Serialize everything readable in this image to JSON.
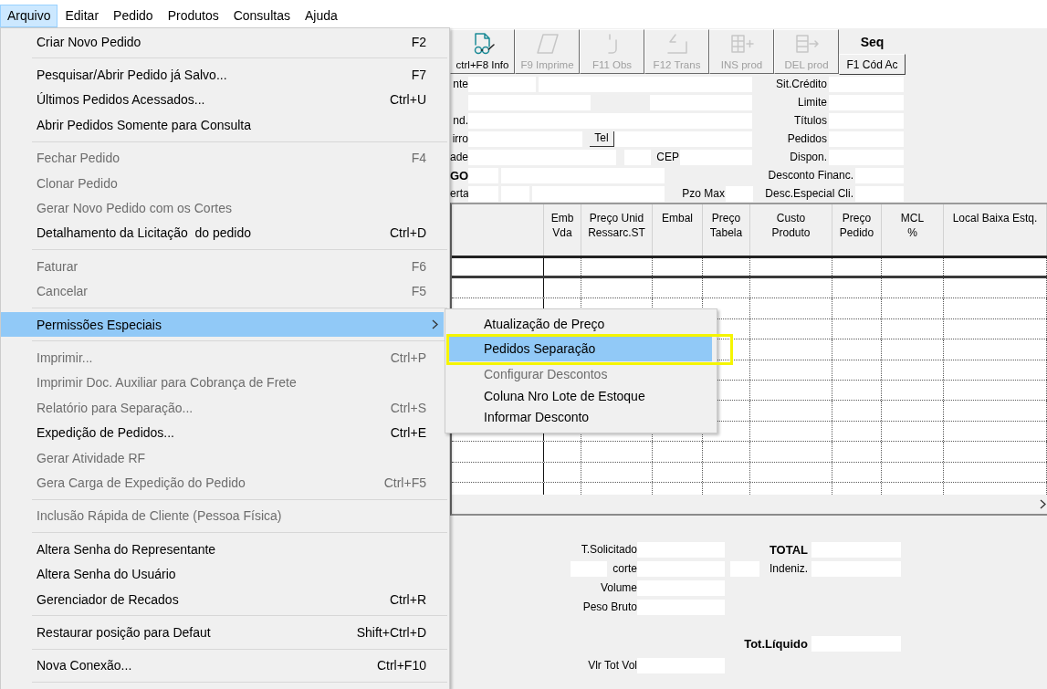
{
  "menu_bar": [
    {
      "label": "Arquivo",
      "selected": true
    },
    {
      "label": "Editar",
      "selected": false
    },
    {
      "label": "Pedido",
      "selected": false
    },
    {
      "label": "Produtos",
      "selected": false
    },
    {
      "label": "Consultas",
      "selected": false
    },
    {
      "label": "Ajuda",
      "selected": false
    }
  ],
  "file_menu": {
    "items": [
      {
        "kind": "item",
        "label": "Criar Novo Pedido",
        "shortcut": "F2",
        "disabled": false,
        "selected": false
      },
      {
        "kind": "separator"
      },
      {
        "kind": "item",
        "label": "Pesquisar/Abrir Pedido já Salvo...",
        "shortcut": "F7",
        "disabled": false,
        "selected": false
      },
      {
        "kind": "item",
        "label": "Últimos Pedidos Acessados...",
        "shortcut": "Ctrl+U",
        "disabled": false,
        "selected": false
      },
      {
        "kind": "item",
        "label": "Abrir Pedidos Somente para Consulta",
        "disabled": false,
        "selected": false
      },
      {
        "kind": "separator"
      },
      {
        "kind": "item",
        "label": "Fechar Pedido",
        "shortcut": "F4",
        "disabled": true,
        "selected": false
      },
      {
        "kind": "item",
        "label": "Clonar Pedido",
        "disabled": true,
        "selected": false
      },
      {
        "kind": "item",
        "label": "Gerar Novo Pedido com os Cortes",
        "disabled": true,
        "selected": false
      },
      {
        "kind": "item",
        "label": "Detalhamento da Licitação  do pedido",
        "shortcut": "Ctrl+D",
        "disabled": false,
        "selected": false
      },
      {
        "kind": "separator"
      },
      {
        "kind": "item",
        "label": "Faturar",
        "shortcut": "F6",
        "disabled": true,
        "selected": false
      },
      {
        "kind": "item",
        "label": "Cancelar",
        "shortcut": "F5",
        "disabled": true,
        "selected": false
      },
      {
        "kind": "separator"
      },
      {
        "kind": "submenu",
        "label": "Permissões Especiais",
        "disabled": false,
        "selected": true,
        "expanded": true,
        "items": [
          {
            "label": "Atualização de Preço",
            "disabled": false,
            "selected": false,
            "marked": false
          },
          {
            "label": "Pedidos Separação",
            "disabled": false,
            "selected": true,
            "marked": true
          },
          {
            "label": "Configurar Descontos",
            "disabled": true,
            "selected": false,
            "marked": false
          },
          {
            "label": "Coluna Nro Lote de Estoque",
            "disabled": false,
            "selected": false,
            "marked": false
          },
          {
            "label": "Informar Desconto",
            "disabled": false,
            "selected": false,
            "marked": false
          }
        ]
      },
      {
        "kind": "separator"
      },
      {
        "kind": "item",
        "label": "Imprimir...",
        "shortcut": "Ctrl+P",
        "disabled": true,
        "selected": false
      },
      {
        "kind": "item",
        "label": "Imprimir Doc. Auxiliar para Cobrança de Frete",
        "disabled": true,
        "selected": false
      },
      {
        "kind": "item",
        "label": "Relatório para Separação...",
        "shortcut": "Ctrl+S",
        "disabled": true,
        "selected": false
      },
      {
        "kind": "item",
        "label": "Expedição de Pedidos...",
        "shortcut": "Ctrl+E",
        "disabled": false,
        "selected": false
      },
      {
        "kind": "item",
        "label": "Gerar Atividade RF",
        "disabled": true,
        "selected": false
      },
      {
        "kind": "item",
        "label": "Gera Carga de Expedição do Pedido",
        "shortcut": "Ctrl+F5",
        "disabled": true,
        "selected": false
      },
      {
        "kind": "separator"
      },
      {
        "kind": "item",
        "label": "Inclusão Rápida de Cliente (Pessoa Física)",
        "disabled": true,
        "selected": false
      },
      {
        "kind": "separator"
      },
      {
        "kind": "item",
        "label": "Altera Senha do Representante",
        "disabled": false,
        "selected": false
      },
      {
        "kind": "item",
        "label": "Altera Senha do Usuário",
        "disabled": false,
        "selected": false
      },
      {
        "kind": "item",
        "label": "Gerenciador de Recados",
        "shortcut": "Ctrl+R",
        "disabled": false,
        "selected": false
      },
      {
        "kind": "separator"
      },
      {
        "kind": "item",
        "label": "Restaurar posição para Defaut",
        "shortcut": "Shift+Ctrl+D",
        "disabled": false,
        "selected": false
      },
      {
        "kind": "separator"
      },
      {
        "kind": "item",
        "label": "Nova Conexão...",
        "shortcut": "Ctrl+F10",
        "disabled": false,
        "selected": false
      },
      {
        "kind": "separator"
      }
    ]
  },
  "toolbar": {
    "buttons": [
      {
        "label": "ctrl+F8 Info",
        "disabled": false
      },
      {
        "label": "F9 Imprime",
        "disabled": true
      },
      {
        "label": "F11 Obs",
        "disabled": true
      },
      {
        "label": "F12 Trans",
        "disabled": true
      },
      {
        "label": "INS prod",
        "disabled": true
      },
      {
        "label": "DEL prod",
        "disabled": true
      }
    ],
    "seq_title": "Seq",
    "seq_button": "F1 Cód Ac"
  },
  "customer_form": {
    "rows": [
      {
        "label": "nte",
        "right_label": "Sit.Crédito"
      },
      {
        "right_label": "Limite"
      },
      {
        "label": "nd.",
        "right_label": "Títulos"
      },
      {
        "label": "irro",
        "button": "Tel",
        "right_label": "Pedidos"
      },
      {
        "label": "ade",
        "middle_label": "CEP",
        "right_label": "Dispon."
      },
      {
        "label": "GO",
        "right_label": "Desconto Financ."
      },
      {
        "label": "erta",
        "middle_label": "Pzo Max",
        "right_label": "Desc.Especial Cli."
      }
    ]
  },
  "items_table": {
    "columns": [
      "Emb\nVda",
      "Preço Unid\nRessarc.ST",
      "Embal",
      "Preço\nTabela",
      "Custo\nProduto",
      "Preço\nPedido",
      "MCL\n%",
      "Local Baixa Estq."
    ]
  },
  "totals": {
    "rows": [
      {
        "left_label": "T.Solicitado",
        "right_label": "TOTAL"
      },
      {
        "left_label": "corte",
        "right_label": "Indeniz."
      },
      {
        "left_label": "Volume"
      },
      {
        "left_label": "Peso Bruto"
      },
      {
        "right_label": "Tot.Líquido"
      },
      {
        "left_label": "Vlr Tot Vol"
      }
    ]
  }
}
